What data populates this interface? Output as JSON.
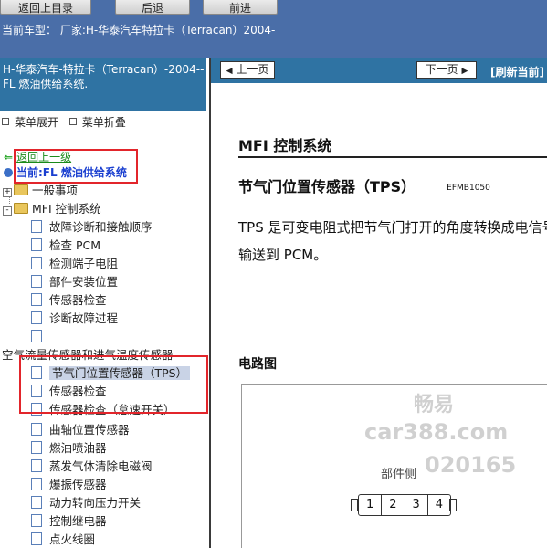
{
  "top_buttons": [
    "返回上目录",
    "后退",
    "前进"
  ],
  "model_bar": {
    "text": "当前车型： 厂家:H-华泰汽车特拉卡（Terracan）2004-"
  },
  "left_header": {
    "title": "H-华泰汽车-特拉卡（Terracan）-2004-- FL 燃油供给系统."
  },
  "menu_ops": {
    "expand": "菜单展开",
    "collapse": "菜单折叠"
  },
  "nav": {
    "back_link": "返回上一级",
    "current": "当前:FL 燃油供给系统"
  },
  "tree": {
    "general": "一般事项",
    "mfi": "MFI 控制系统",
    "mfi_children": [
      "故障诊断和接触顺序",
      "检查 PCM",
      "检测端子电阻",
      "部件安装位置",
      "传感器检查",
      "诊断故障过程",
      ""
    ],
    "air_flow": "空气流量传感器和进气温度传感器",
    "tps_group": [
      "节气门位置传感器（TPS）",
      "传感器检查",
      "传感器检查（怠速开关）"
    ],
    "rest": [
      "曲轴位置传感器",
      "燃油喷油器",
      "蒸发气体清除电磁阀",
      "爆振传感器",
      "动力转向压力开关",
      "控制继电器",
      "点火线圈",
      ""
    ]
  },
  "right_nav": {
    "prev": "上一页",
    "next": "下一页",
    "refresh": "[刷新当前]"
  },
  "doc": {
    "section_title": "MFI 控制系统",
    "subtitle": "节气门位置传感器（TPS）",
    "code": "EFMB1050",
    "paragraph": "TPS 是可变电阻式把节气门打开的角度转换成电信号输送到 PCM。",
    "circuit_title": "电路图",
    "part_side": "部件侧",
    "pins": [
      "1",
      "2",
      "3",
      "4"
    ]
  },
  "watermark": {
    "line1": "畅易",
    "line2": "car388.com",
    "line3": "020165"
  }
}
